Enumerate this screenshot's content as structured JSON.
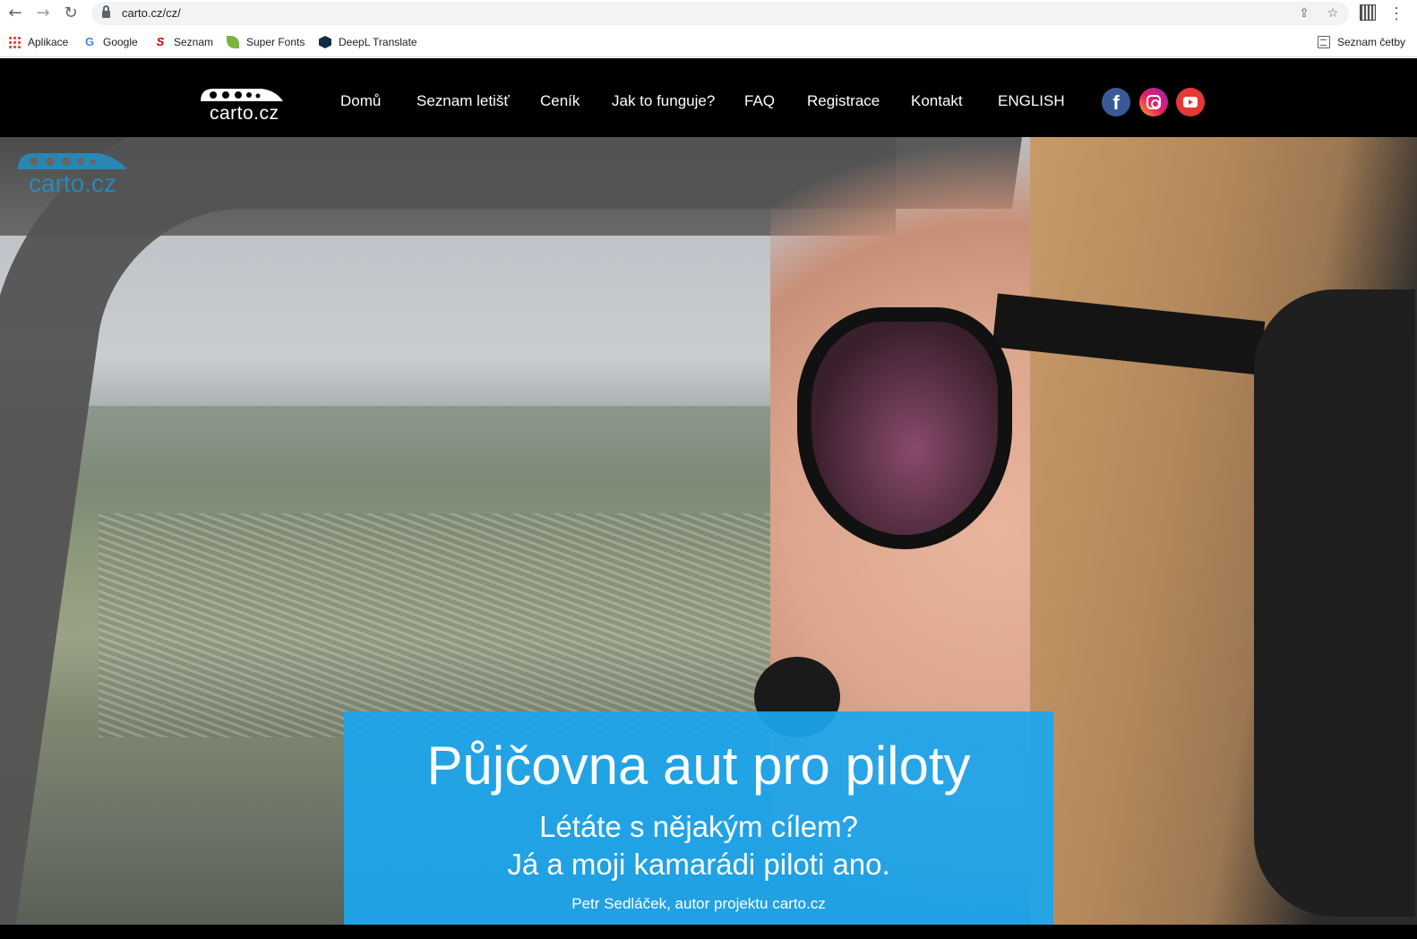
{
  "browser": {
    "url": "carto.cz/cz/",
    "bookmarks": [
      {
        "label": "Aplikace",
        "icon": "apps-grid-icon"
      },
      {
        "label": "Google",
        "icon": "google-icon"
      },
      {
        "label": "Seznam",
        "icon": "seznam-icon"
      },
      {
        "label": "Super Fonts",
        "icon": "leaf-icon"
      },
      {
        "label": "DeepL Translate",
        "icon": "deepl-icon"
      }
    ],
    "reading_list": "Seznam četby"
  },
  "site": {
    "logo_text": "carto.cz",
    "watermark_text": "carto.cz",
    "nav": [
      "Domů",
      "Seznam letišť",
      "Ceník",
      "Jak to funguje?",
      "FAQ",
      "Registrace",
      "Kontakt",
      "ENGLISH"
    ],
    "social": {
      "facebook": "f"
    }
  },
  "hero": {
    "title": "Půjčovna aut pro piloty",
    "subtitle_line1": "Létáte s nějakým cílem?",
    "subtitle_line2": "Já a moji kamarádi piloti ano.",
    "author": "Petr Sedláček, autor projektu carto.cz"
  },
  "colors": {
    "callout_blue": "#1ba6ee",
    "facebook": "#3b5998",
    "youtube": "#e53935"
  }
}
